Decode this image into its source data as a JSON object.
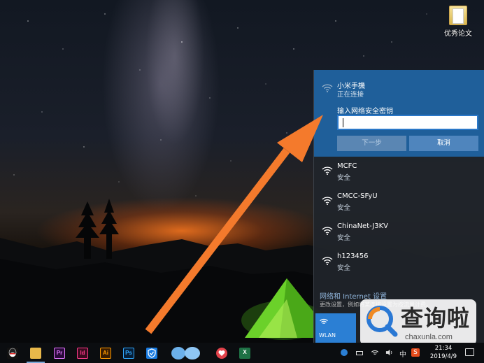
{
  "desktop": {
    "icons": [
      {
        "label": "优秀论文",
        "icon": "folder-icon"
      }
    ]
  },
  "wifi_flyout": {
    "connecting_network": {
      "name": "小米手機",
      "status": "正在连接",
      "password_label": "输入网络安全密钥",
      "password_value": "",
      "next_button": "下一步",
      "cancel_button": "取消"
    },
    "networks": [
      {
        "name": "MCFC",
        "status": "安全"
      },
      {
        "name": "CMCC-SFyU",
        "status": "安全"
      },
      {
        "name": "ChinaNet-J3KV",
        "status": "安全"
      },
      {
        "name": "h123456",
        "status": "安全"
      }
    ],
    "settings_link": "网络和 Internet 设置",
    "settings_sub": "更改设置，例如将某连接设置为按流量计费。",
    "wlan_tile_label": "WLAN"
  },
  "watermark": {
    "text": "查询啦",
    "url": "chaxunla.com"
  },
  "taskbar": {
    "apps": [
      {
        "name": "qq-icon",
        "label": ""
      },
      {
        "name": "file-explorer-icon",
        "label": ""
      },
      {
        "name": "premiere-icon",
        "label": "Pr"
      },
      {
        "name": "indesign-icon",
        "label": "Id"
      },
      {
        "name": "illustrator-icon",
        "label": "Ai"
      },
      {
        "name": "photoshop-icon",
        "label": "Ps"
      },
      {
        "name": "shield-app-icon",
        "label": ""
      },
      {
        "name": "heart-app-icon",
        "label": ""
      },
      {
        "name": "excel-icon",
        "label": "X"
      }
    ],
    "tray": {
      "ime": "中",
      "sogou": "S",
      "time": "21:34",
      "date": "2019/4/9"
    }
  },
  "colors": {
    "accent": "#1f5f9a",
    "arrow": "#f47a2c",
    "wlan_tile": "#2b7fd4"
  }
}
